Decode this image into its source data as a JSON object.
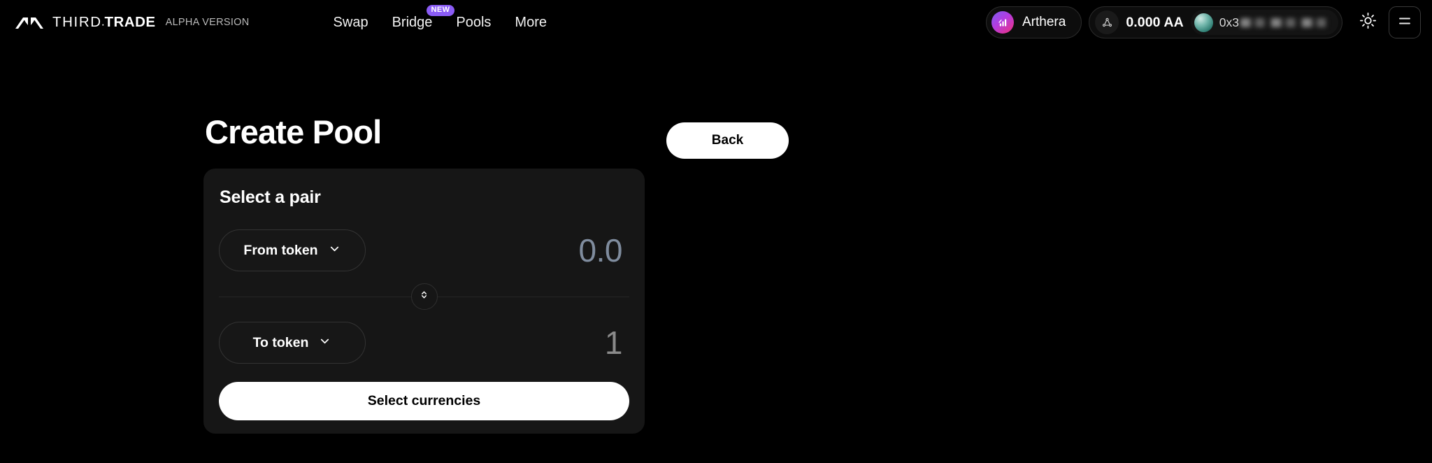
{
  "brand": {
    "logo_icon": "third-trade-logo-icon",
    "name_part1": "THIRD",
    "name_dot": ".",
    "name_part2": "TRADE",
    "version_label": "ALPHA VERSION"
  },
  "nav": {
    "items": [
      {
        "label": "Swap",
        "badge": null
      },
      {
        "label": "Bridge",
        "badge": "NEW"
      },
      {
        "label": "Pools",
        "badge": null
      },
      {
        "label": "More",
        "badge": null
      }
    ]
  },
  "header_right": {
    "network_chip": {
      "icon": "arthera-logo-icon",
      "label": "Arthera"
    },
    "wallet_chip": {
      "network_icon": "network-nodes-icon",
      "balance": "0.000 AA",
      "avatar_icon": "wallet-avatar-icon",
      "address": "0x3"
    },
    "theme_toggle_icon": "sun-icon",
    "menu_icon": "hamburger-menu-icon"
  },
  "page": {
    "title": "Create Pool",
    "back_label": "Back"
  },
  "card": {
    "title": "Select a pair",
    "from": {
      "selector_label": "From token",
      "chevron_icon": "chevron-down-icon",
      "amount": "0.0"
    },
    "swap_icon": "swap-vertical-icon",
    "to": {
      "selector_label": "To token",
      "chevron_icon": "chevron-down-icon",
      "amount": "1"
    },
    "submit_label": "Select currencies"
  },
  "colors": {
    "background": "#000000",
    "card": "#161616",
    "accent_badge": "#8b5cf6",
    "primary_button": "#ffffff",
    "amount_from": "#7f8c9e",
    "amount_to": "#8a8a8a"
  }
}
